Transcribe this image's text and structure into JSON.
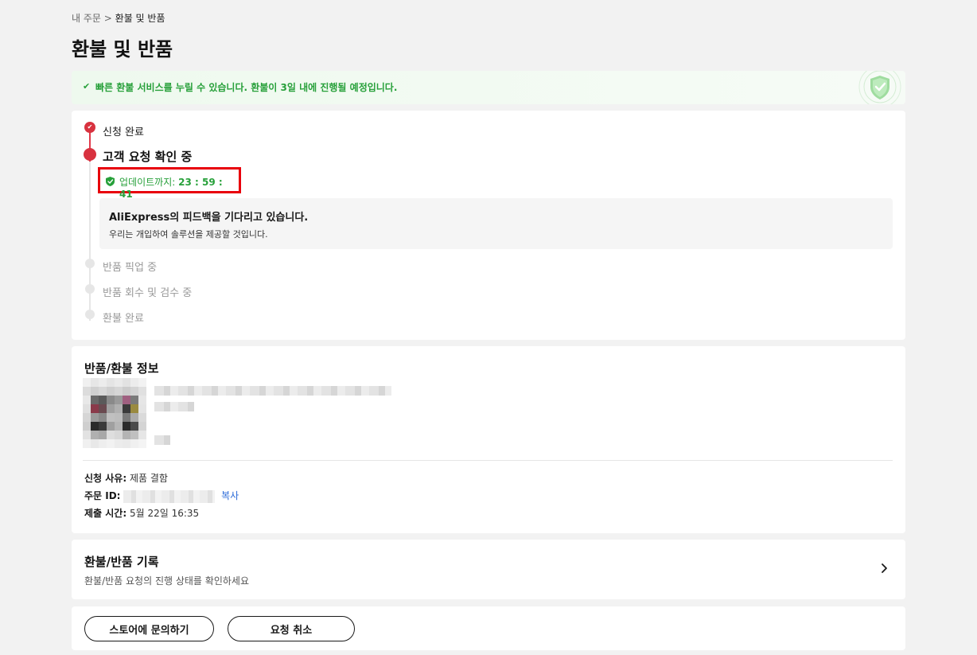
{
  "breadcrumb": {
    "parent": "내 주문",
    "separator": ">",
    "current": "환불 및 반품"
  },
  "page_title": "환불 및 반품",
  "banner": {
    "text": "빠른 환불 서비스를 누릴 수 있습니다. 환불이 3일 내에 진행될 예정입니다.",
    "check": "✔"
  },
  "timeline": {
    "steps": [
      {
        "label": "신청 완료",
        "state": "done"
      },
      {
        "label": "고객 요청 확인 중",
        "state": "active"
      },
      {
        "label": "반품 픽업 중",
        "state": "pending"
      },
      {
        "label": "반품 회수 및 검수 중",
        "state": "pending"
      },
      {
        "label": "환불 완료",
        "state": "pending"
      }
    ],
    "timer_label": "업데이트까지:",
    "timer_value": "23 : 59 : 41",
    "feedback_title": "AliExpress의 피드백을 기다리고 있습니다.",
    "feedback_sub": "우리는 개입하여 솔루션을 제공할 것입니다."
  },
  "return_info": {
    "title": "반품/환불 정보",
    "reason_label": "신청 사유:",
    "reason_value": "제품 결함",
    "order_id_label": "주문 ID:",
    "copy_label": "복사",
    "submitted_label": "제출 시간:",
    "submitted_value": "5월 22일 16:35"
  },
  "history": {
    "title": "환불/반품 기록",
    "subtitle": "환불/반품 요청의 진행 상태를 확인하세요"
  },
  "actions": {
    "contact_store": "스토어에 문의하기",
    "cancel_request": "요청 취소"
  },
  "colors": {
    "accent_red": "#d8323f",
    "success_green": "#27a03a",
    "link_blue": "#2a6ad8",
    "highlight_border": "#e8000b"
  }
}
